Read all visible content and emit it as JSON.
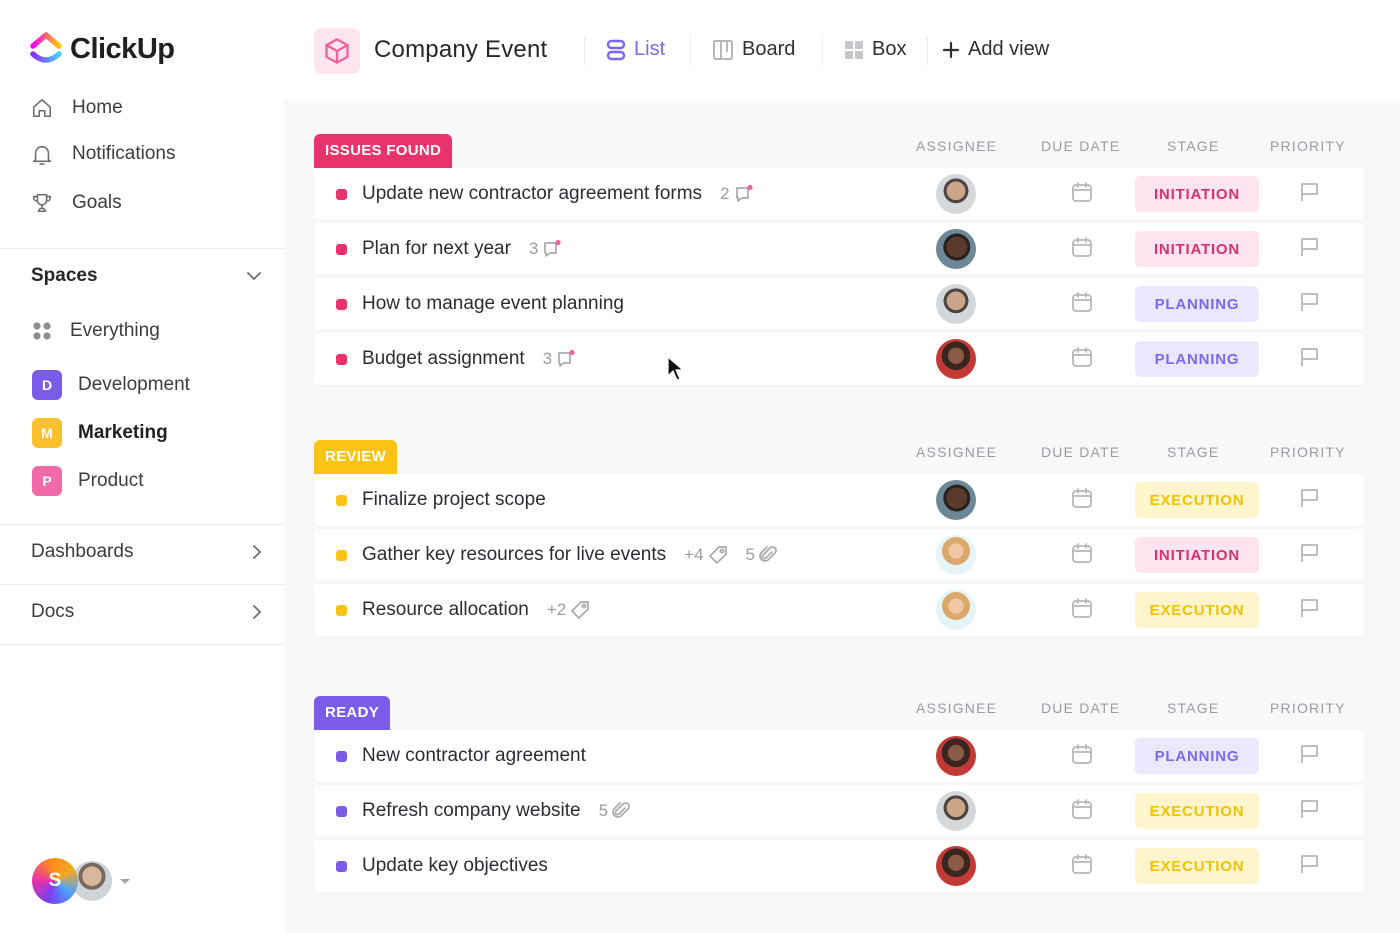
{
  "app": {
    "name": "ClickUp"
  },
  "sidebar": {
    "nav": [
      {
        "label": "Home",
        "icon": "home-icon"
      },
      {
        "label": "Notifications",
        "icon": "bell-icon"
      },
      {
        "label": "Goals",
        "icon": "trophy-icon"
      }
    ],
    "spaces_title": "Spaces",
    "everything_label": "Everything",
    "spaces": [
      {
        "letter": "D",
        "label": "Development",
        "color": "#7b5ce8",
        "active": false
      },
      {
        "letter": "M",
        "label": "Marketing",
        "color": "#fbc02d",
        "active": true
      },
      {
        "letter": "P",
        "label": "Product",
        "color": "#f06ba8",
        "active": false
      }
    ],
    "dashboards_label": "Dashboards",
    "docs_label": "Docs",
    "user_initial": "S"
  },
  "topbar": {
    "project_title": "Company Event",
    "views": [
      {
        "label": "List",
        "icon": "list-icon",
        "active": true
      },
      {
        "label": "Board",
        "icon": "board-icon",
        "active": false
      },
      {
        "label": "Box",
        "icon": "box-icon",
        "active": false
      }
    ],
    "add_view_label": "Add view"
  },
  "columns": {
    "assignee": "ASSIGNEE",
    "due_date": "DUE DATE",
    "stage": "STAGE",
    "priority": "PRIORITY"
  },
  "stage_styles": {
    "INITIATION": {
      "bg": "#fde4ee",
      "fg": "#d6336c"
    },
    "PLANNING": {
      "bg": "#ebe8fd",
      "fg": "#7b68ee"
    },
    "EXECUTION": {
      "bg": "#fff5cc",
      "fg": "#f2c200"
    }
  },
  "groups": [
    {
      "label": "ISSUES FOUND",
      "color": "#e8336d",
      "tasks": [
        {
          "name": "Update new contractor agreement forms",
          "comments": "2",
          "stage": "INITIATION",
          "avatar": "man-glasses"
        },
        {
          "name": "Plan for next year",
          "comments": "3",
          "stage": "INITIATION",
          "avatar": "man-dark"
        },
        {
          "name": "How to manage event planning",
          "stage": "PLANNING",
          "avatar": "man-glasses"
        },
        {
          "name": "Budget assignment",
          "comments": "3",
          "stage": "PLANNING",
          "avatar": "woman-red"
        }
      ]
    },
    {
      "label": "REVIEW",
      "color": "#fbc415",
      "tasks": [
        {
          "name": "Finalize project scope",
          "stage": "EXECUTION",
          "avatar": "man-dark"
        },
        {
          "name": "Gather key resources for live events",
          "tags": "+4",
          "attachments": "5",
          "stage": "INITIATION",
          "avatar": "woman-blonde"
        },
        {
          "name": "Resource allocation",
          "tags": "+2",
          "stage": "EXECUTION",
          "avatar": "woman-blonde"
        }
      ]
    },
    {
      "label": "READY",
      "color": "#7b5ce8",
      "tasks": [
        {
          "name": "New contractor agreement",
          "stage": "PLANNING",
          "avatar": "woman-red"
        },
        {
          "name": "Refresh company website",
          "attachments": "5",
          "stage": "EXECUTION",
          "avatar": "man-glasses"
        },
        {
          "name": "Update key objectives",
          "stage": "EXECUTION",
          "avatar": "woman-red"
        }
      ]
    }
  ]
}
